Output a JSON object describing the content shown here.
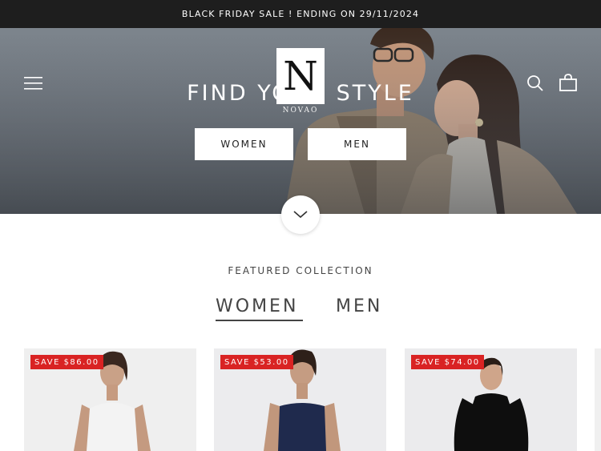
{
  "announcement": {
    "text": "BLACK FRIDAY SALE ! ENDING ON 29/11/2024"
  },
  "header": {
    "logo_letter": "N",
    "logo_wordmark": "NOVAO",
    "icons": [
      "menu-icon",
      "search-icon",
      "cart-icon"
    ]
  },
  "hero": {
    "title": "FIND YOUR STYLE",
    "buttons": {
      "women": "WOMEN",
      "men": "MEN"
    }
  },
  "featured": {
    "label": "FEATURED COLLECTION",
    "tabs": [
      {
        "label": "WOMEN",
        "active": true
      },
      {
        "label": "MEN",
        "active": false
      }
    ],
    "products": [
      {
        "badge": "SAVE $86.00",
        "dress_color": "#f2f2f2"
      },
      {
        "badge": "SAVE $53.00",
        "dress_color": "#1f2a4d"
      },
      {
        "badge": "SAVE $74.00",
        "dress_color": "#0e0e0e"
      }
    ]
  },
  "colors": {
    "announcement_bg": "#1e1e1e",
    "sale_badge": "#d92323",
    "text_dark": "#444444"
  }
}
